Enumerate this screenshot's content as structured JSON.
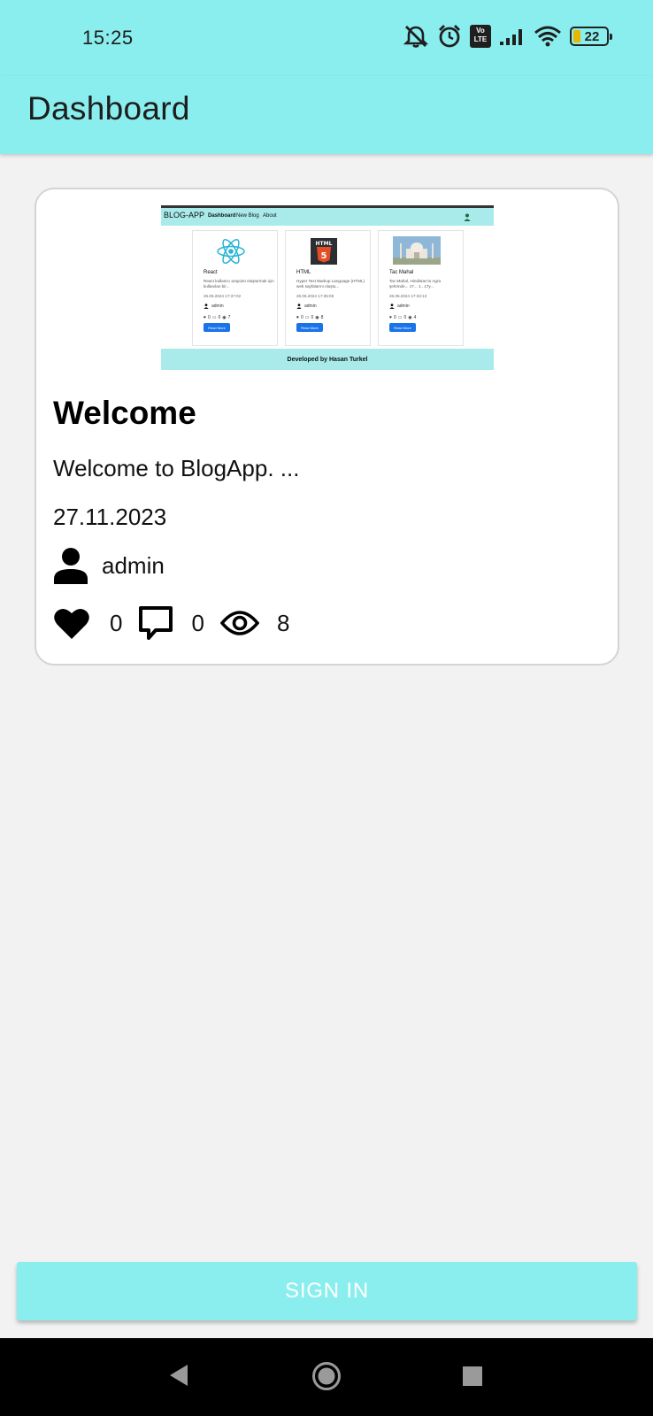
{
  "status_bar": {
    "time": "15:25",
    "icons": [
      "bell-off-icon",
      "alarm-icon",
      "volte-icon",
      "signal-icon",
      "wifi-icon",
      "battery-icon"
    ],
    "volte_label_top": "Vo",
    "volte_label_bottom": "LTE",
    "battery_level": "22"
  },
  "app_bar": {
    "title": "Dashboard"
  },
  "post_card": {
    "thumbnail": {
      "brand": "BLOG-APP",
      "nav_links": [
        "Dashboard",
        "New Blog",
        "About"
      ],
      "cards": [
        {
          "title": "React",
          "desc": "React kullanıcı arayüzü oluşturmak için kullanılan bir...",
          "date": "26.06.2024 17:37:02",
          "author": "admin",
          "likes": "0",
          "comments": "0",
          "views": "7",
          "button": "Read More",
          "image": "react-logo"
        },
        {
          "title": "HTML",
          "desc": "Hyper Text Markup Language (HTML) web sayfalarını oluştu...",
          "date": "26.06.2024 17:35:06",
          "author": "admin",
          "likes": "0",
          "comments": "0",
          "views": "8",
          "button": "Read More",
          "image": "html5-logo"
        },
        {
          "title": "Tac Mahal",
          "desc": "Tac Mahal, Hindistan'ın Agra şehrinde... 17... 1.. 17y...",
          "date": "26.06.2024 17:33:13",
          "author": "admin",
          "likes": "0",
          "comments": "0",
          "views": "4",
          "button": "Read More",
          "image": "taj-mahal-photo"
        }
      ],
      "footer": "Developed by Hasan Turkel"
    },
    "title": "Welcome",
    "description": "Welcome to BlogApp. ...",
    "date": "27.11.2023",
    "author": "admin",
    "likes": "0",
    "comments": "0",
    "views": "8"
  },
  "sign_in_button": {
    "label": "SIGN IN"
  },
  "navigation_bar": {
    "buttons": [
      "back-icon",
      "home-icon",
      "recents-icon"
    ]
  },
  "colors": {
    "accent": "#8aeeee",
    "background": "#f2f2f2"
  }
}
